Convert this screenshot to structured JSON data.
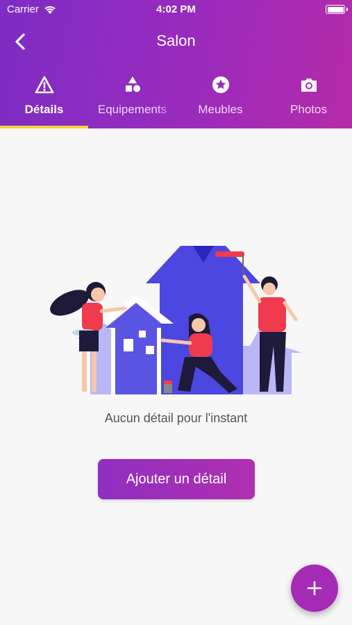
{
  "status_bar": {
    "carrier": "Carrier",
    "time": "4:02 PM"
  },
  "header": {
    "title": "Salon"
  },
  "tabs": [
    {
      "label": "Détails",
      "icon": "warning-triangle-icon",
      "active": true
    },
    {
      "label": "Equipements",
      "icon": "shapes-icon",
      "active": false
    },
    {
      "label": "Meubles",
      "icon": "star-circle-icon",
      "active": false
    },
    {
      "label": "Photos",
      "icon": "camera-icon",
      "active": false
    }
  ],
  "empty_state": {
    "message": "Aucun détail pour l'instant",
    "button_label": "Ajouter un détail"
  },
  "fab": {
    "icon": "plus-icon"
  },
  "colors": {
    "header_gradient_start": "#7d2cc4",
    "header_gradient_end": "#b52ba8",
    "tab_indicator": "#f4d33b",
    "fab": "#a52bb6",
    "illustration_blue": "#4b47e0",
    "illustration_red": "#ef3b4d"
  }
}
